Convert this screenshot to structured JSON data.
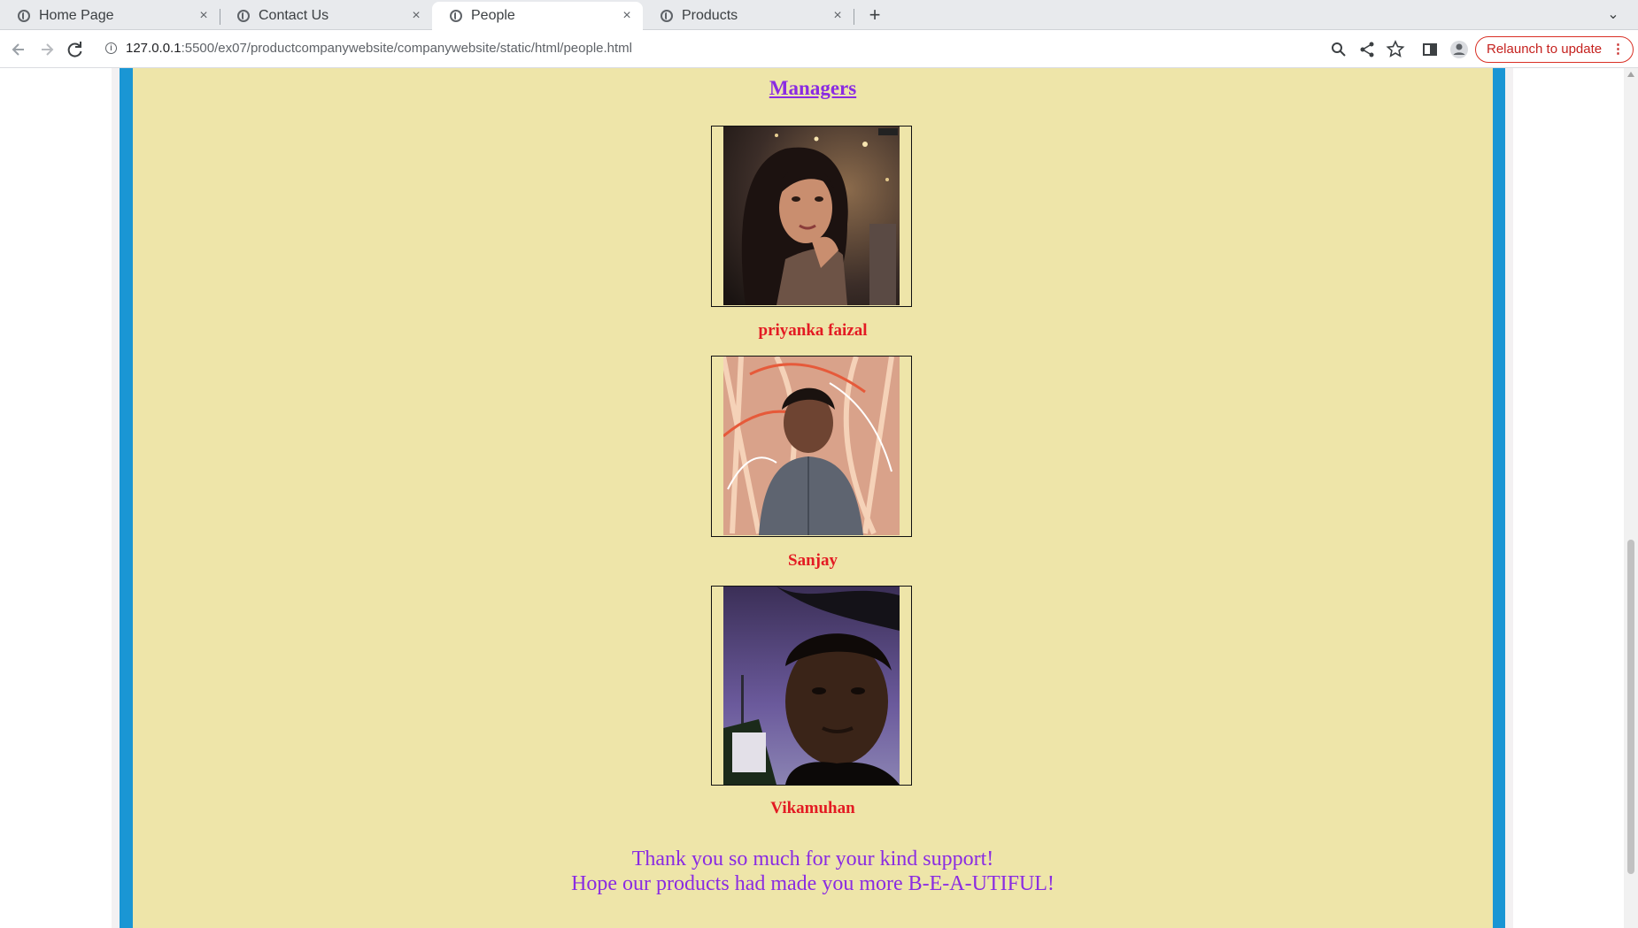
{
  "browser": {
    "tabs": [
      {
        "label": "Home Page",
        "active": false
      },
      {
        "label": "Contact Us",
        "active": false
      },
      {
        "label": "People",
        "active": true
      },
      {
        "label": "Products",
        "active": false
      }
    ],
    "new_tab": "+",
    "tab_close": "×",
    "tab_list": "⌄",
    "url_host": "127.0.0.1",
    "url_rest": ":5500/ex07/productcompanywebsite/companywebsite/static/html/people.html",
    "relaunch_label": "Relaunch to update",
    "relaunch_menu": "⋮"
  },
  "page": {
    "section_title": "Managers",
    "people": [
      {
        "name": "priyanka faizal",
        "photo": "photo of a woman with long dark hair resting chin on hand"
      },
      {
        "name": "Sanjay",
        "photo": "photo of a man in a grey shirt in front of lights"
      },
      {
        "name": "Vikamuhan",
        "photo": "selfie of a young man at dusk"
      }
    ],
    "thanks_line1": "Thank you so much for your kind support!",
    "thanks_line2": "Hope our products had made you more B-E-A-UTIFUL!"
  },
  "colors": {
    "page_bg": "#eee5a9",
    "border": "#1a96d4",
    "heading": "#8a2be2",
    "names": "#e31b23"
  }
}
